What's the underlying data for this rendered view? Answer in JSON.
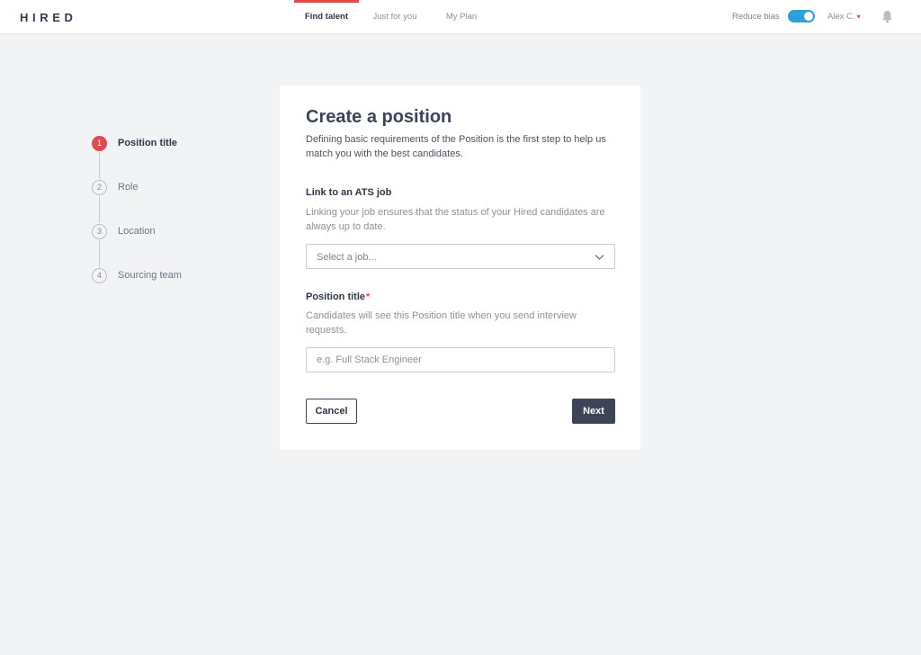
{
  "header": {
    "logo": "HIRED",
    "tabs": [
      {
        "label": "Find talent",
        "active": true
      },
      {
        "label": "Just for you",
        "active": false
      },
      {
        "label": "My Plan",
        "active": false
      }
    ],
    "reduce_bias_label": "Reduce bias",
    "reduce_bias_on": true,
    "user_name": "Alex C.",
    "caret": "▾",
    "bell_icon": "bell-icon"
  },
  "stepper": {
    "steps": [
      {
        "number": "1",
        "label": "Position title",
        "active": true
      },
      {
        "number": "2",
        "label": "Role",
        "active": false
      },
      {
        "number": "3",
        "label": "Location",
        "active": false
      },
      {
        "number": "4",
        "label": "Sourcing team",
        "active": false
      }
    ]
  },
  "form": {
    "title": "Create a position",
    "description": "Defining basic requirements of the Position is the first step to help us match you with the best candidates.",
    "ats": {
      "label": "Link to an ATS job",
      "help": "Linking your job ensures that the status of your Hired candidates are always up to date.",
      "select_value": "Select a job..."
    },
    "position": {
      "label": "Position title",
      "required_mark": "*",
      "help": "Candidates will see this Position title when you send interview requests.",
      "placeholder": "e.g. Full Stack Engineer",
      "value": ""
    },
    "cancel_label": "Cancel",
    "next_label": "Next"
  },
  "colors": {
    "accent_red": "#e0494f",
    "toggle_blue": "#2f9fd8",
    "primary_button": "#3d4457",
    "page_bg": "#f2f3f5"
  }
}
